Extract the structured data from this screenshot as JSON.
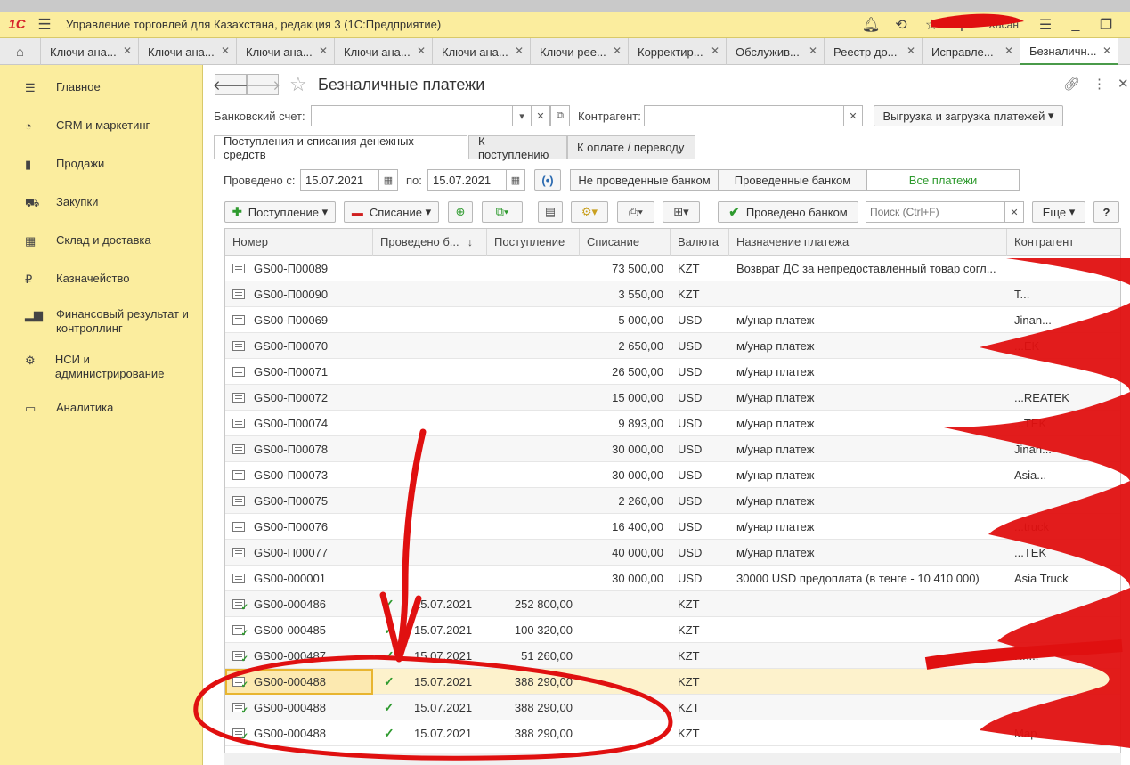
{
  "app": {
    "title": "Управление торговлей для Казахстана, редакция 3  (1С:Предприятие)",
    "user": "Хасан",
    "logo": "1С"
  },
  "tabs": [
    "Ключи ана...",
    "Ключи ана...",
    "Ключи ана...",
    "Ключи ана...",
    "Ключи ана...",
    "Ключи рее...",
    "Корректир...",
    "Обслужив...",
    "Реестр до...",
    "Исправле...",
    "Безналичн..."
  ],
  "sidebar": [
    {
      "label": "Главное",
      "icon": "menu-icon"
    },
    {
      "label": "CRM и маркетинг",
      "icon": "pie-chart-icon"
    },
    {
      "label": "Продажи",
      "icon": "bag-icon"
    },
    {
      "label": "Закупки",
      "icon": "cart-icon"
    },
    {
      "label": "Склад и доставка",
      "icon": "grid-icon"
    },
    {
      "label": "Казначейство",
      "icon": "coin-icon"
    },
    {
      "label": "Финансовый результат и контроллинг",
      "icon": "bar-chart-icon"
    },
    {
      "label": "НСИ и администрирование",
      "icon": "gear-icon"
    },
    {
      "label": "Аналитика",
      "icon": "monitor-icon"
    }
  ],
  "form": {
    "title": "Безналичные платежи",
    "bank_account_label": "Банковский счет:",
    "counterparty_label": "Контрагент:",
    "export_button": "Выгрузка и загрузка платежей",
    "form_tabs": [
      "Поступления и списания денежных средств",
      "К поступлению",
      "К оплате / переводу"
    ],
    "date_from_label": "Проведено с:",
    "date_from": "15.07.2021",
    "date_to_label": "по:",
    "date_to": "15.07.2021",
    "filter_options": [
      "Не проведенные банком",
      "Проведенные банком",
      "Все платежи"
    ],
    "btn_income": "Поступление",
    "btn_expense": "Списание",
    "btn_posted_by_bank": "Проведено банком",
    "search_placeholder": "Поиск (Ctrl+F)",
    "btn_more": "Еще",
    "btn_help": "?"
  },
  "table": {
    "columns": [
      "Номер",
      "Проведено б...",
      "Поступление",
      "Списание",
      "Валюта",
      "Назначение платежа",
      "Контрагент"
    ],
    "rows": [
      {
        "num": "GS00-П00089",
        "posted": "",
        "date": "",
        "income": "",
        "expense": "73 500,00",
        "cur": "KZT",
        "purpose": "Возврат ДС за непредоставленный товар  согл...",
        "cp": ""
      },
      {
        "num": "GS00-П00090",
        "posted": "",
        "date": "",
        "income": "",
        "expense": "3 550,00",
        "cur": "KZT",
        "purpose": "",
        "cp": "Т..."
      },
      {
        "num": "GS00-П00069",
        "posted": "",
        "date": "",
        "income": "",
        "expense": "5 000,00",
        "cur": "USD",
        "purpose": "м/унар платеж",
        "cp": "Jinan..."
      },
      {
        "num": "GS00-П00070",
        "posted": "",
        "date": "",
        "income": "",
        "expense": "2 650,00",
        "cur": "USD",
        "purpose": "м/унар платеж",
        "cp": "...EK"
      },
      {
        "num": "GS00-П00071",
        "posted": "",
        "date": "",
        "income": "",
        "expense": "26 500,00",
        "cur": "USD",
        "purpose": "м/унар платеж",
        "cp": ""
      },
      {
        "num": "GS00-П00072",
        "posted": "",
        "date": "",
        "income": "",
        "expense": "15 000,00",
        "cur": "USD",
        "purpose": "м/унар платеж",
        "cp": "...REATEK"
      },
      {
        "num": "GS00-П00074",
        "posted": "",
        "date": "",
        "income": "",
        "expense": "9 893,00",
        "cur": "USD",
        "purpose": "м/унар платеж",
        "cp": "...TEK"
      },
      {
        "num": "GS00-П00078",
        "posted": "",
        "date": "",
        "income": "",
        "expense": "30 000,00",
        "cur": "USD",
        "purpose": "м/унар платеж",
        "cp": "Jinan..."
      },
      {
        "num": "GS00-П00073",
        "posted": "",
        "date": "",
        "income": "",
        "expense": "30 000,00",
        "cur": "USD",
        "purpose": "м/унар платеж",
        "cp": "Asia..."
      },
      {
        "num": "GS00-П00075",
        "posted": "",
        "date": "",
        "income": "",
        "expense": "2 260,00",
        "cur": "USD",
        "purpose": "м/унар платеж",
        "cp": ""
      },
      {
        "num": "GS00-П00076",
        "posted": "",
        "date": "",
        "income": "",
        "expense": "16 400,00",
        "cur": "USD",
        "purpose": "м/унар платеж",
        "cp": "...truck"
      },
      {
        "num": "GS00-П00077",
        "posted": "",
        "date": "",
        "income": "",
        "expense": "40 000,00",
        "cur": "USD",
        "purpose": "м/унар платеж",
        "cp": "...TEK"
      },
      {
        "num": "GS00-000001",
        "posted": "",
        "date": "",
        "income": "",
        "expense": "30 000,00",
        "cur": "USD",
        "purpose": "30000 USD предоплата (в тенге - 10 410 000)",
        "cp": "Asia Truck"
      },
      {
        "num": "GS00-000486",
        "posted": "✓",
        "date": "15.07.2021",
        "income": "252 800,00",
        "expense": "",
        "cur": "KZT",
        "purpose": "",
        "cp": ""
      },
      {
        "num": "GS00-000485",
        "posted": "✓",
        "date": "15.07.2021",
        "income": "100 320,00",
        "expense": "",
        "cur": "KZT",
        "purpose": "",
        "cp": ""
      },
      {
        "num": "GS00-000487",
        "posted": "✓",
        "date": "15.07.2021",
        "income": "51 260,00",
        "expense": "",
        "cur": "KZT",
        "purpose": "",
        "cp": "Ин..."
      },
      {
        "num": "GS00-000488",
        "posted": "✓",
        "date": "15.07.2021",
        "income": "388 290,00",
        "expense": "",
        "cur": "KZT",
        "purpose": "",
        "cp": ""
      },
      {
        "num": "GS00-000488",
        "posted": "✓",
        "date": "15.07.2021",
        "income": "388 290,00",
        "expense": "",
        "cur": "KZT",
        "purpose": "",
        "cp": ""
      },
      {
        "num": "GS00-000488",
        "posted": "✓",
        "date": "15.07.2021",
        "income": "388 290,00",
        "expense": "",
        "cur": "KZT",
        "purpose": "",
        "cp": "Мар..."
      }
    ]
  },
  "colors": {
    "sidebar_bg": "#fbed9e",
    "accent_green": "#2e9a2e",
    "annotation_red": "#e01010",
    "selected_row": "#fdf2cc"
  }
}
